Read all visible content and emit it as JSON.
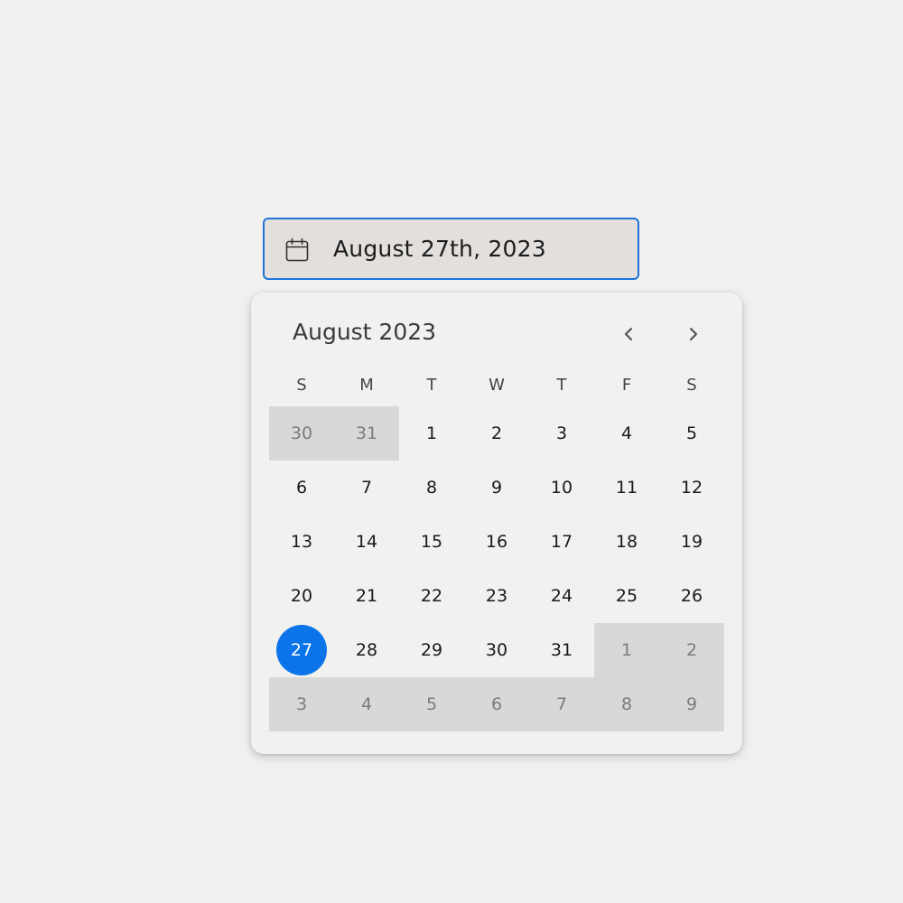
{
  "date_input": {
    "value": "August 27th, 2023",
    "icon": "calendar-icon",
    "border_color": "#1f73d8"
  },
  "calendar": {
    "month_label": "August 2023",
    "prev_icon": "chevron-left-icon",
    "next_icon": "chevron-right-icon",
    "weekdays": [
      "S",
      "M",
      "T",
      "W",
      "T",
      "F",
      "S"
    ],
    "selected_color": "#0b74e8",
    "weeks": [
      [
        {
          "d": "30",
          "out": true
        },
        {
          "d": "31",
          "out": true
        },
        {
          "d": "1"
        },
        {
          "d": "2"
        },
        {
          "d": "3"
        },
        {
          "d": "4"
        },
        {
          "d": "5"
        }
      ],
      [
        {
          "d": "6"
        },
        {
          "d": "7"
        },
        {
          "d": "8"
        },
        {
          "d": "9"
        },
        {
          "d": "10"
        },
        {
          "d": "11"
        },
        {
          "d": "12"
        }
      ],
      [
        {
          "d": "13"
        },
        {
          "d": "14"
        },
        {
          "d": "15"
        },
        {
          "d": "16"
        },
        {
          "d": "17"
        },
        {
          "d": "18"
        },
        {
          "d": "19"
        }
      ],
      [
        {
          "d": "20"
        },
        {
          "d": "21"
        },
        {
          "d": "22"
        },
        {
          "d": "23"
        },
        {
          "d": "24"
        },
        {
          "d": "25"
        },
        {
          "d": "26"
        }
      ],
      [
        {
          "d": "27",
          "selected": true
        },
        {
          "d": "28"
        },
        {
          "d": "29"
        },
        {
          "d": "30"
        },
        {
          "d": "31"
        },
        {
          "d": "1",
          "out": true
        },
        {
          "d": "2",
          "out": true
        }
      ],
      [
        {
          "d": "3",
          "out": true
        },
        {
          "d": "4",
          "out": true
        },
        {
          "d": "5",
          "out": true
        },
        {
          "d": "6",
          "out": true
        },
        {
          "d": "7",
          "out": true
        },
        {
          "d": "8",
          "out": true
        },
        {
          "d": "9",
          "out": true
        }
      ]
    ]
  }
}
